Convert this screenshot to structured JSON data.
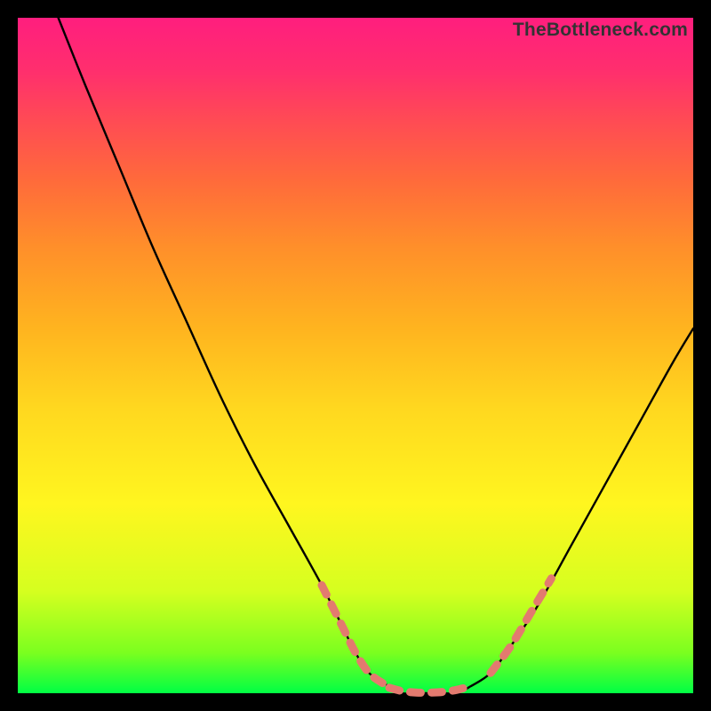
{
  "watermark": "TheBottleneck.com",
  "chart_data": {
    "type": "line",
    "title": "",
    "xlabel": "",
    "ylabel": "",
    "xlim": [
      0,
      100
    ],
    "ylim": [
      0,
      100
    ],
    "series": [
      {
        "name": "bottleneck-curve",
        "x": [
          6,
          10,
          15,
          20,
          25,
          30,
          35,
          40,
          45,
          48,
          50,
          52,
          55,
          57,
          60,
          63,
          65,
          67,
          70,
          73,
          77,
          82,
          87,
          92,
          97,
          100
        ],
        "y": [
          100,
          90,
          78,
          66,
          55,
          44,
          34,
          25,
          16,
          10,
          6,
          3,
          1,
          0,
          0,
          0,
          0,
          1,
          3,
          7,
          13,
          22,
          31,
          40,
          49,
          54
        ]
      }
    ],
    "markers": {
      "name": "dashed-highlight",
      "segments": [
        {
          "x": [
            45,
            48,
            50,
            52,
            54
          ],
          "y": [
            16,
            10,
            6,
            3,
            1.5
          ]
        },
        {
          "x": [
            55,
            57,
            59,
            61,
            63,
            65,
            67
          ],
          "y": [
            0.8,
            0.3,
            0.1,
            0.1,
            0.2,
            0.5,
            1.0
          ]
        },
        {
          "x": [
            70,
            73,
            76,
            79
          ],
          "y": [
            3,
            7,
            12,
            17
          ]
        }
      ]
    },
    "colors": {
      "curve": "#000000",
      "marker": "#e37a6f",
      "background_top": "#ff1e7e",
      "background_bottom": "#00ff44"
    }
  }
}
